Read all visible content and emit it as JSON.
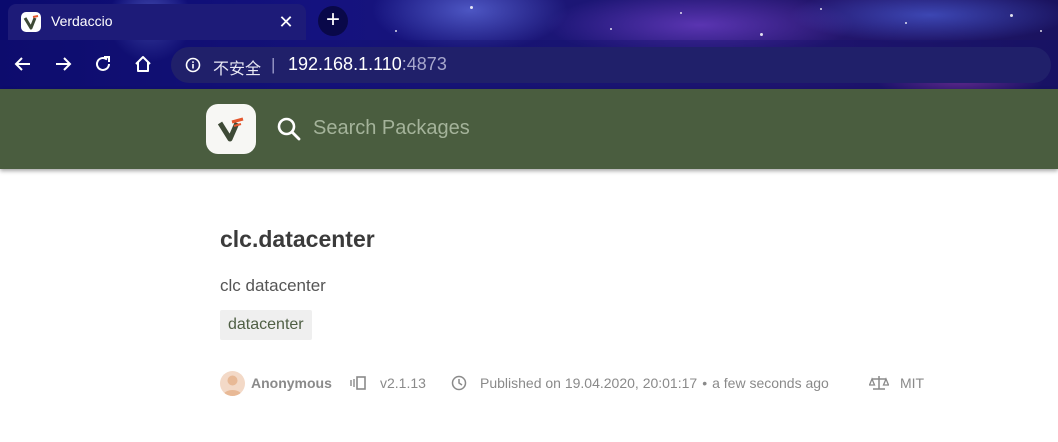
{
  "browser": {
    "tab": {
      "title": "Verdaccio",
      "favicon": "verdaccio-logo-icon",
      "close_icon": "close-icon"
    },
    "new_tab_icon": "plus-icon",
    "nav": {
      "back_icon": "back-arrow-icon",
      "forward_icon": "forward-arrow-icon",
      "reload_icon": "reload-icon",
      "home_icon": "home-icon"
    },
    "address_bar": {
      "security_icon": "info-icon",
      "security_label": "不安全",
      "separator": "|",
      "host": "192.168.1.110",
      "port": ":4873"
    }
  },
  "header": {
    "logo": "verdaccio-logo-icon",
    "search_icon": "search-icon",
    "search_placeholder": "Search Packages",
    "background_color": "#4a5d3f"
  },
  "package": {
    "name": "clc.datacenter",
    "description": "clc datacenter",
    "keywords": [
      "datacenter"
    ],
    "author": "Anonymous",
    "version": "v2.1.13",
    "published": "Published on 19.04.2020, 20:01:17",
    "published_relative": "a few seconds ago",
    "published_separator": "•",
    "license": "MIT",
    "icons": {
      "author": "avatar-icon",
      "version": "version-icon",
      "published": "clock-icon",
      "license": "scale-icon"
    }
  }
}
